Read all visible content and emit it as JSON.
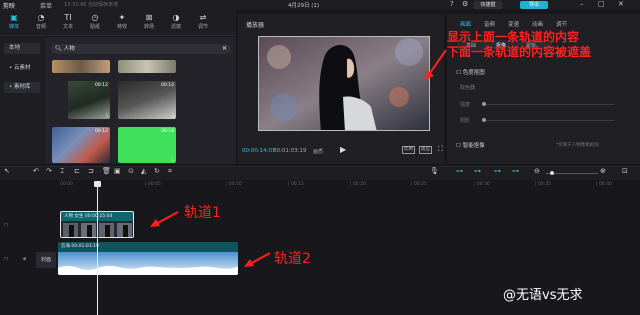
{
  "app": {
    "logo": "剪映",
    "menu": "菜单",
    "autosave": "13:31:45 自动保存本地",
    "title": "4月29日 (1)",
    "shortcut": "快捷键",
    "export": "导出"
  },
  "toolbar": {
    "items": [
      {
        "label": "媒体",
        "icon": "media-icon"
      },
      {
        "label": "音频",
        "icon": "audio-icon"
      },
      {
        "label": "文本",
        "icon": "text-icon"
      },
      {
        "label": "贴纸",
        "icon": "sticker-icon"
      },
      {
        "label": "特效",
        "icon": "effects-icon"
      },
      {
        "label": "转场",
        "icon": "transition-icon"
      },
      {
        "label": "滤镜",
        "icon": "filter-icon"
      },
      {
        "label": "调节",
        "icon": "adjust-icon"
      }
    ]
  },
  "sidebar": {
    "items": [
      {
        "label": "本地"
      },
      {
        "label": "• 云素材"
      },
      {
        "label": "• 素材库"
      }
    ]
  },
  "media": {
    "search_value": "人物",
    "thumbs": [
      {
        "duration": "00:12"
      },
      {
        "duration": "00:14"
      },
      {
        "duration": "00:12"
      },
      {
        "duration": "00:18"
      }
    ]
  },
  "player": {
    "title": "播放器",
    "time_current": "00:00:14:07",
    "time_total": "00:01:03:19",
    "quality": "画质",
    "ratio": "比例",
    "fit": "适应"
  },
  "rightpanel": {
    "tabs": [
      "画面",
      "音频",
      "变速",
      "动画",
      "调节"
    ],
    "subtabs": [
      "基础",
      "抠像",
      "蒙版"
    ],
    "color_grading": "色度抠图",
    "pick_color": "取色器",
    "intensity": "强度",
    "shadow": "阴影",
    "smart_cutout": "智能抠像",
    "hint": "*仅限于人物像素抠除"
  },
  "annotation": {
    "line1": "显示上面一条轨道的内容",
    "line2": "下面一条轨道的内容被遮盖",
    "track1": "轨道1",
    "track2": "轨道2",
    "accent": "#ff2020"
  },
  "timeline": {
    "ticks": [
      "00:00",
      "| 00:05",
      "| 00:10",
      "| 00:15",
      "| 00:20",
      "| 00:25",
      "| 00:30",
      "| 00:35",
      "| 00:40",
      "| 00:45"
    ],
    "cover": "封面",
    "clip1_label": "人物 女生  00:00:25:04",
    "clip2_label": "云海  00:01:03:19"
  },
  "watermark": "@无语vs无求",
  "colors": {
    "accent": "#2fc3df",
    "export_bg": "#20b2d0"
  }
}
